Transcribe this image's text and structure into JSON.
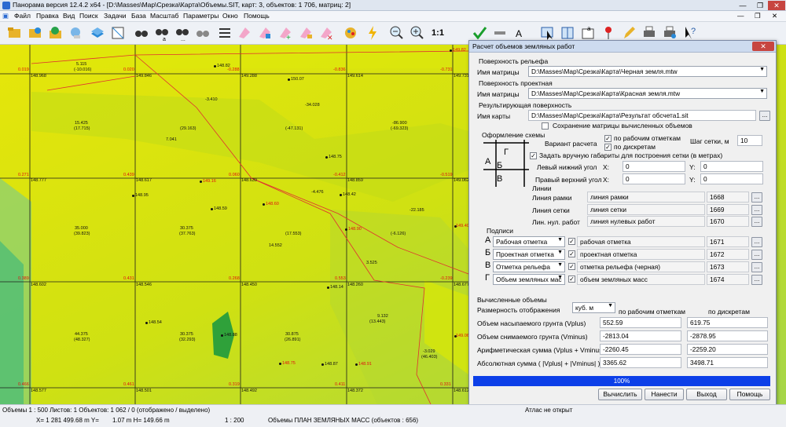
{
  "window": {
    "title": "Панорама версия 12.4.2 x64 - [D:\\Masses\\Map\\Срезка\\Карта\\Объемы.SIT, карт: 3, объектов: 1 706, матриц: 2]"
  },
  "menu": [
    "Файл",
    "Правка",
    "Вид",
    "Поиск",
    "Задачи",
    "База",
    "Масштаб",
    "Параметры",
    "Окно",
    "Помощь"
  ],
  "toolbar": {
    "scale_label": "1:1"
  },
  "map": {
    "cells": [
      {
        "t": "5.115",
        "s": "(-10.016)"
      },
      {
        "t": "15.425",
        "s": "(17.715)"
      },
      {
        "t": "(29.163)",
        "s": ""
      },
      {
        "t": "7.041",
        "s": ""
      },
      {
        "t": "-3.410",
        "s": ""
      },
      {
        "t": "-34.028",
        "s": ""
      },
      {
        "t": "(-47.131)",
        "s": ""
      },
      {
        "t": "-86.900",
        "s": "(-69.323)"
      },
      {
        "t": "35.000",
        "s": "(39.823)"
      },
      {
        "t": "30.375",
        "s": "(37.763)"
      },
      {
        "t": "-4.476",
        "s": ""
      },
      {
        "t": "(17.553)",
        "s": ""
      },
      {
        "t": "14.552",
        "s": ""
      },
      {
        "t": "(-6.126)",
        "s": ""
      },
      {
        "t": "-22.185",
        "s": ""
      },
      {
        "t": "3.525",
        "s": ""
      },
      {
        "t": "44.375",
        "s": "(48.327)"
      },
      {
        "t": "30.375",
        "s": "(32.293)"
      },
      {
        "t": "30.875",
        "s": "(26.891)"
      },
      {
        "t": "9.132",
        "s": "(13.443)"
      },
      {
        "t": "-3.029",
        "s": "(46.403)"
      }
    ],
    "node_labels": [
      {
        "r": "0.019",
        "v": "148.968"
      },
      {
        "r": "0.020",
        "v": "149.846"
      },
      {
        "r": "-0.288",
        "v": "149.288"
      },
      {
        "r": "-0.836",
        "v": "149.614"
      },
      {
        "r": "-0.731",
        "v": "149.731"
      },
      {
        "r": "0.271",
        "v": "148.777"
      },
      {
        "r": "0.439",
        "v": "148.617"
      },
      {
        "r": "0.060",
        "v": "148.639"
      },
      {
        "r": "-0.412",
        "v": "148.859"
      },
      {
        "r": "-0.519",
        "v": "149.062"
      },
      {
        "r": "0.389",
        "v": "148.602"
      },
      {
        "r": "0.431",
        "v": "148.546"
      },
      {
        "r": "0.268",
        "v": "148.450"
      },
      {
        "r": "0.553",
        "v": "148.260"
      },
      {
        "r": "-0.239",
        "v": "148.677"
      },
      {
        "r": "0.466",
        "v": "148.577"
      },
      {
        "r": "0.461",
        "v": "148.501"
      },
      {
        "r": "0.319",
        "v": "148.492"
      },
      {
        "r": "0.411",
        "v": "148.372"
      },
      {
        "r": "0.331",
        "v": "148.612"
      }
    ],
    "point_labels": [
      "148.82",
      "150.07",
      "148.75",
      "149.16",
      "148.95",
      "148.42",
      "148.60",
      "148.59",
      "148.90",
      "148.14",
      "148.54",
      "148.88",
      "148.75",
      "148.87",
      "148.91",
      "149.82",
      "149.40",
      "149.06"
    ]
  },
  "dialog": {
    "title": "Расчет объемов земляных работ",
    "relief_section": "Поверхность рельефа",
    "matrix_label": "Имя матрицы",
    "relief_matrix": "D:\\Masses\\Map\\Срезка\\Карта\\Черная земля.mtw",
    "design_section": "Поверхность проектная",
    "design_matrix": "D:\\Masses\\Map\\Срезка\\Карта\\Красная земля.mtw",
    "result_section": "Результирующая поверхность",
    "map_label": "Имя карты",
    "result_map": "D:\\Masses\\Map\\Срезка\\Карта\\Результат обсчета1.sit",
    "save_matrix": "Сохранение матрицы вычисленных объемов",
    "scheme_title": "Оформление схемы",
    "scheme_letters": [
      "А",
      "Б",
      "В",
      "Г"
    ],
    "calc_variant": "Вариант расчета",
    "by_work_marks": "по рабочим отметкам",
    "by_discrete": "по дискретам",
    "grid_step_label": "Шаг сетки, м",
    "grid_step": "10",
    "manual_bounds": "Задать вручную габариты для построения сетки (в метрах)",
    "lower_left": "Левый нижний угол",
    "upper_right": "Правый верхний угол",
    "x_label": "X:",
    "y_label": "Y:",
    "ll_x": "0",
    "ll_y": "0",
    "ur_x": "0",
    "ur_y": "0",
    "lines_section": "Линии",
    "lines": [
      {
        "label": "Линия рамки",
        "value": "линия рамки",
        "code": "1668"
      },
      {
        "label": "Линия сетки",
        "value": "линия сетки",
        "code": "1669"
      },
      {
        "label": "Лин. нул. работ",
        "value": "линия нулевых работ",
        "code": "1670"
      }
    ],
    "captions_section": "Подписи",
    "captions": [
      {
        "letter": "А",
        "label": "Рабочая отметка",
        "value": "рабочая отметка",
        "code": "1671"
      },
      {
        "letter": "Б",
        "label": "Проектная отметка",
        "value": "проектная отметка",
        "code": "1672"
      },
      {
        "letter": "В",
        "label": "Отметка рельефа",
        "value": "отметка рельефа (черная)",
        "code": "1673"
      },
      {
        "letter": "Г",
        "label": "Объем земляных мас",
        "value": "объем земляных масс",
        "code": "1674"
      }
    ],
    "computed_section": "Вычисленные объемы",
    "units_label": "Размерность отображения",
    "units": "куб. м",
    "col_work": "по рабочим отметкам",
    "col_discrete": "по дискретам",
    "volumes": [
      {
        "label": "Объем насыпаемого грунта (Vplus)",
        "a": "552.59",
        "b": "619.75"
      },
      {
        "label": "Объем снимаемого грунта (Vminus)",
        "a": "-2813.04",
        "b": "-2878.95"
      },
      {
        "label": "Арифметическая сумма (Vplus + Vminus)",
        "a": "-2260.45",
        "b": "-2259.20"
      },
      {
        "label": "Абсолютная сумма ( |Vplus| + |Vminus| )",
        "a": "3365.62",
        "b": "3498.71"
      }
    ],
    "progress": "100%",
    "buttons": {
      "calc": "Вычислить",
      "find": "Нанести",
      "exit": "Выход",
      "help": "Помощь"
    }
  },
  "status": {
    "line1_left": "Объемы  1 : 500  Листов: 1  Объектов: 1 062 / 0 (отображено / выделено)",
    "line1_right": "Атлас не открыт",
    "line2_coords": "X= 1 281 499.68 m  Y=",
    "line2_mid": "1.07 m  H= 149.66 m",
    "line2_scale": "1 : 200",
    "line2_layer": "Объемы ПЛАН ЗЕМЛЯНЫХ МАСС  (объектов : 656)"
  }
}
